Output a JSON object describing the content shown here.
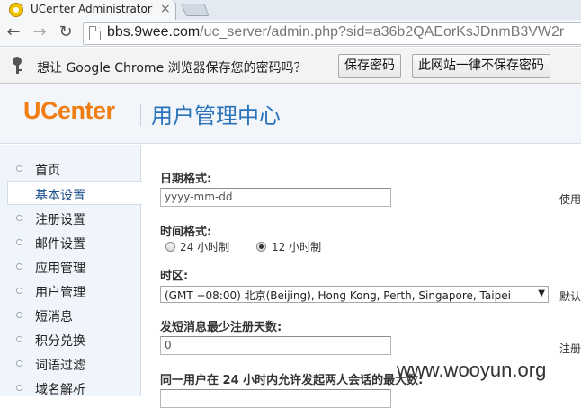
{
  "browser": {
    "tab_title": "UCenter Administrator's",
    "tab_close": "×",
    "back": "←",
    "forward": "→",
    "reload": "↻",
    "url_host": "bbs.9wee.com",
    "url_path": "/uc_server/admin.php?sid=a36b2QAEorKsJDnmB3VW2r"
  },
  "infobar": {
    "message": "想让 Google Chrome 浏览器保存您的密码吗？",
    "save_label": "保存密码",
    "never_label": "此网站一律不保存密码"
  },
  "header": {
    "logo": "UCenter",
    "title": "用户管理中心"
  },
  "sidebar": {
    "items": [
      {
        "label": "首页"
      },
      {
        "label": "基本设置"
      },
      {
        "label": "注册设置"
      },
      {
        "label": "邮件设置"
      },
      {
        "label": "应用管理"
      },
      {
        "label": "用户管理"
      },
      {
        "label": "短消息"
      },
      {
        "label": "积分兑换"
      },
      {
        "label": "词语过滤"
      },
      {
        "label": "域名解析"
      }
    ]
  },
  "form": {
    "date_format_label": "日期格式:",
    "date_format_value": "yyyy-mm-dd",
    "date_format_hint": "使用",
    "time_format_label": "时间格式:",
    "time_24_label": "24 小时制",
    "time_12_label": "12 小时制",
    "timezone_label": "时区:",
    "timezone_value": "(GMT +08:00) 北京(Beijing), Hong Kong, Perth, Singapore, Taipei",
    "timezone_arrow": "▼",
    "timezone_hint": "默认",
    "pm_days_label": "发短消息最少注册天数:",
    "pm_days_value": "0",
    "pm_days_hint": "注册",
    "pm_limit_label": "同一用户在 24 小时内允许发起两人会话的最大数:"
  },
  "watermark": "www.wooyun.org"
}
